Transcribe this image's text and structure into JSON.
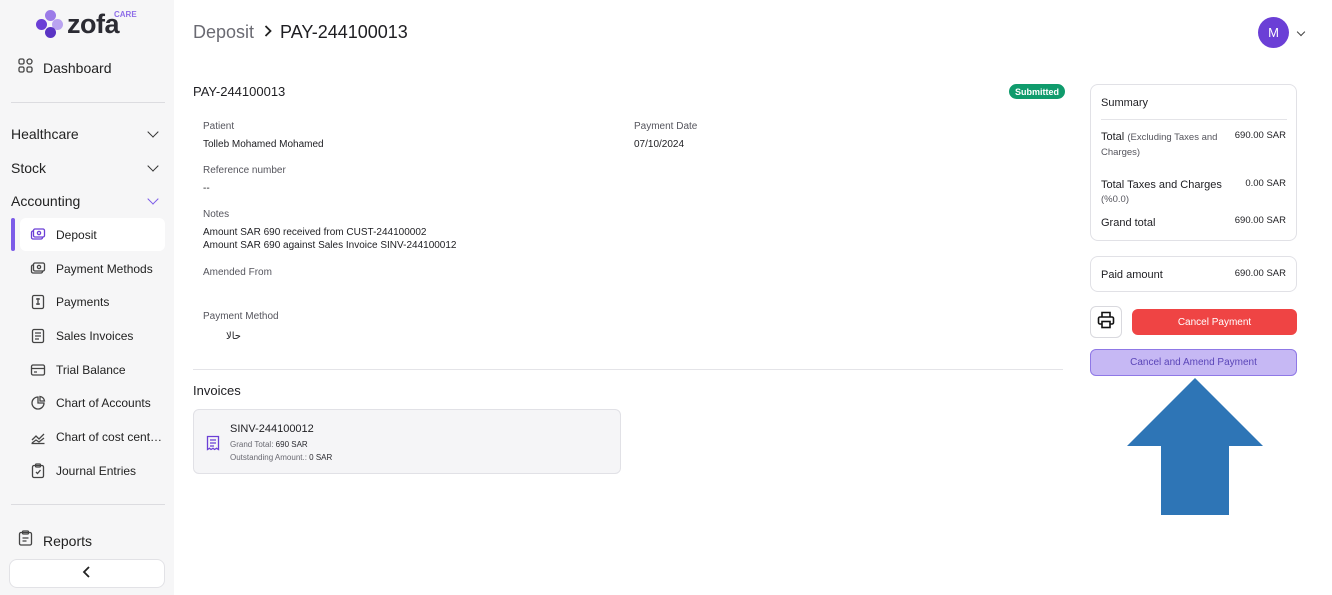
{
  "brand": {
    "logo_text": "zofa",
    "logo_tag": "CARE"
  },
  "sidebar": {
    "dashboard": "Dashboard",
    "groups": [
      {
        "label": "Healthcare"
      },
      {
        "label": "Stock"
      },
      {
        "label": "Accounting"
      }
    ],
    "items": [
      {
        "label": "Deposit",
        "icon": "deposit-icon"
      },
      {
        "label": "Payment Methods",
        "icon": "payment-methods-icon"
      },
      {
        "label": "Payments",
        "icon": "payments-icon"
      },
      {
        "label": "Sales Invoices",
        "icon": "sales-invoice-icon"
      },
      {
        "label": "Trial Balance",
        "icon": "trial-balance-icon"
      },
      {
        "label": "Chart of Accounts",
        "icon": "pie-chart-icon"
      },
      {
        "label": "Chart of cost cente...",
        "icon": "line-chart-icon"
      },
      {
        "label": "Journal Entries",
        "icon": "journal-icon"
      }
    ],
    "reports": "Reports"
  },
  "header": {
    "crumb_parent": "Deposit",
    "crumb_current": "PAY-244100013",
    "avatar_initial": "M"
  },
  "doc": {
    "title": "PAY-244100013",
    "status": "Submitted",
    "patient_label": "Patient",
    "patient_value": "Tolleb Mohamed Mohamed",
    "payment_date_label": "Payment Date",
    "payment_date_value": "07/10/2024",
    "reference_label": "Reference number",
    "reference_value": "--",
    "notes_label": "Notes",
    "notes_line1": "Amount SAR 690 received from CUST-244100002",
    "notes_line2": "Amount SAR 690 against Sales Invoice SINV-244100012",
    "amended_label": "Amended From",
    "payment_method_label": "Payment Method",
    "payment_method_value": "حالا"
  },
  "invoices": {
    "title": "Invoices",
    "items": [
      {
        "name": "SINV-244100012",
        "grand_total_label": "Grand Total:",
        "grand_total": "690 SAR",
        "outstanding_label": "Outstanding Amount.:",
        "outstanding": "0 SAR"
      }
    ]
  },
  "summary": {
    "title": "Summary",
    "total_label": "Total",
    "total_note": "(Excluding Taxes and Charges)",
    "total_value": "690.00 SAR",
    "taxes_label": "Total Taxes and Charges",
    "taxes_note": "(%0.0)",
    "taxes_value": "0.00 SAR",
    "grand_label": "Grand total",
    "grand_value": "690.00 SAR",
    "paid_label": "Paid amount",
    "paid_value": "690.00 SAR"
  },
  "actions": {
    "cancel": "Cancel Payment",
    "cancel_amend": "Cancel and Amend Payment"
  },
  "colors": {
    "accent": "#7c5ce8",
    "status_green": "#0f9b6c",
    "danger": "#ef4444",
    "annotation_arrow": "#2e75b6"
  }
}
